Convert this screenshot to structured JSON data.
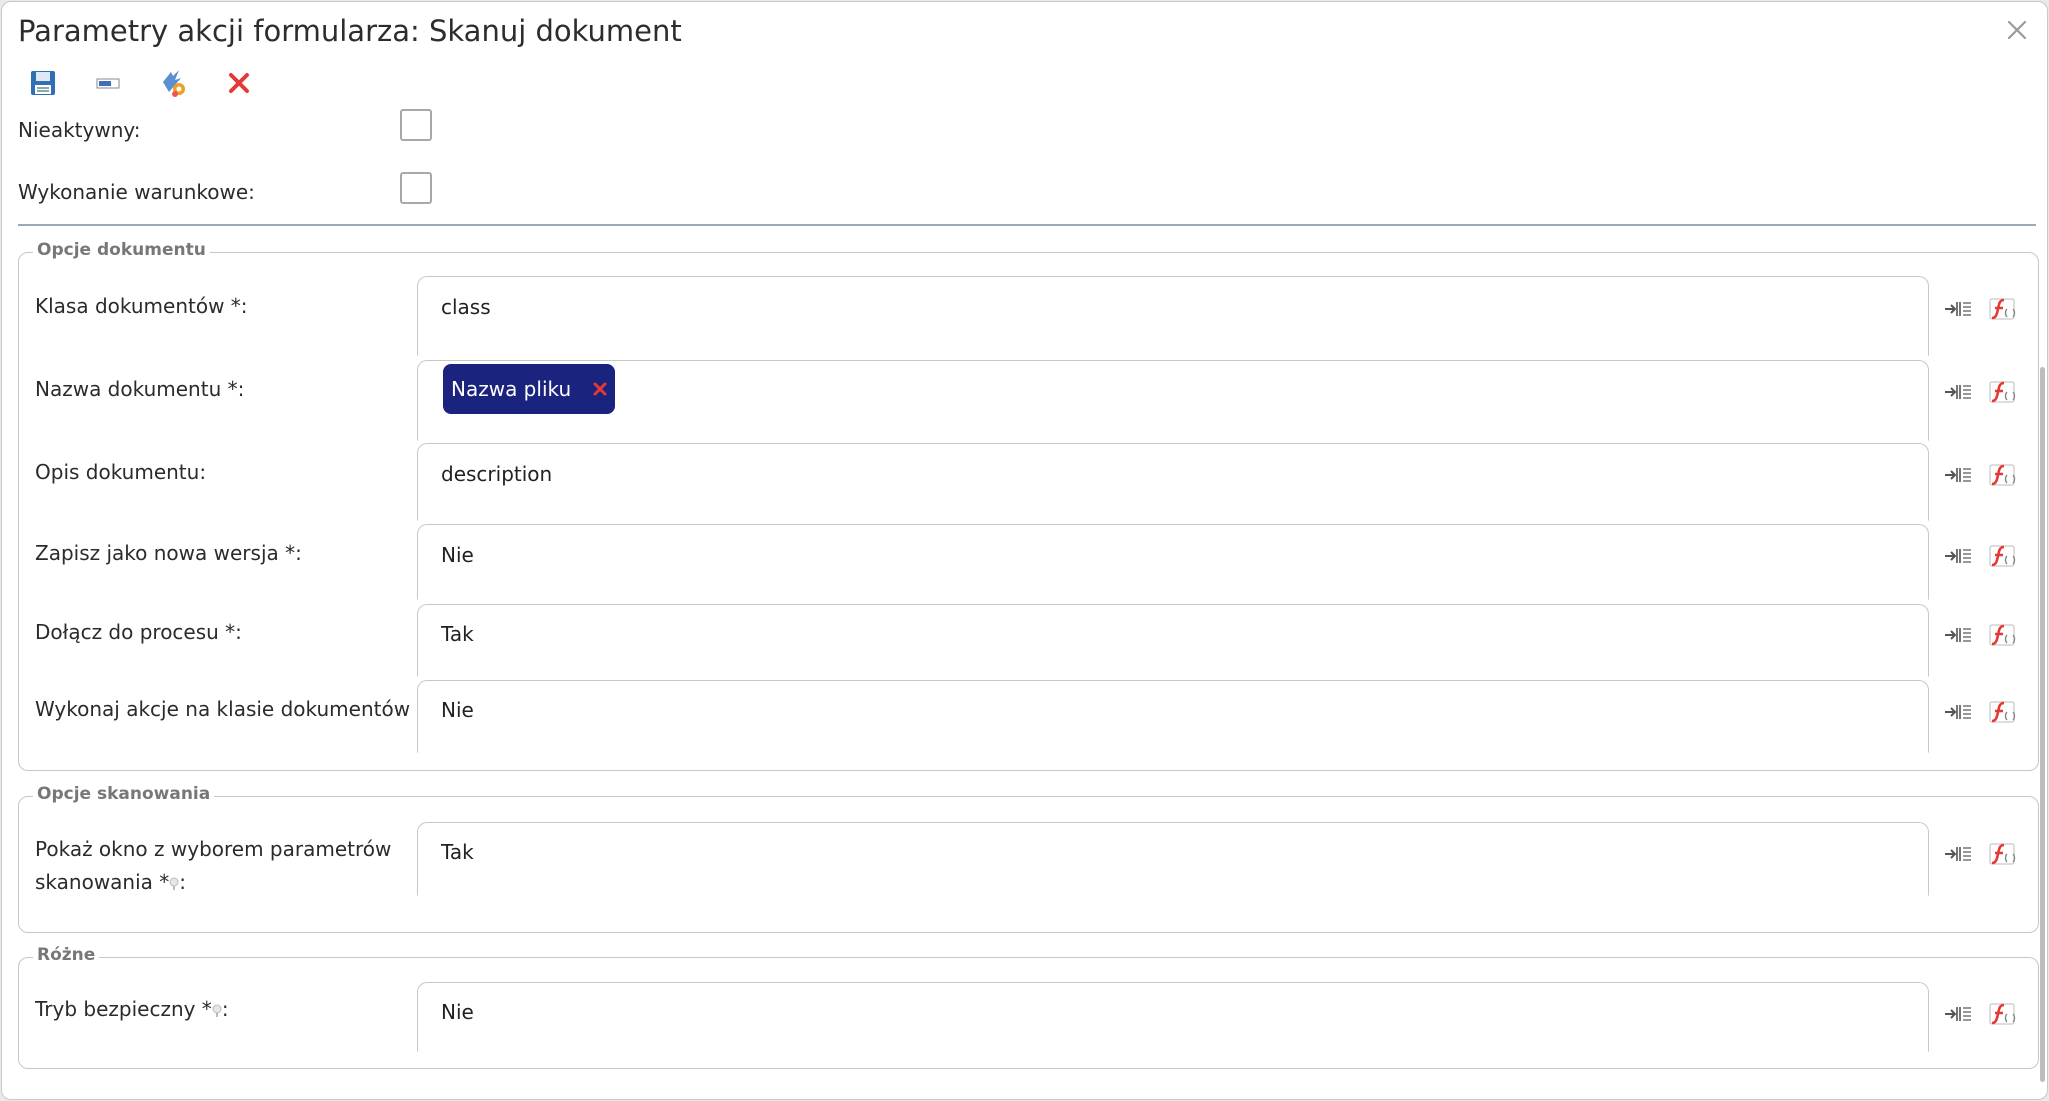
{
  "dialog": {
    "title": "Parametry akcji formularza: Skanuj dokument"
  },
  "toolbar": {
    "buttons": [
      {
        "name": "save-icon"
      },
      {
        "name": "form-field-icon"
      },
      {
        "name": "settings-variables-icon"
      },
      {
        "name": "delete-icon"
      }
    ]
  },
  "general": {
    "inactive_label": "Nieaktywny:",
    "inactive_checked": false,
    "conditional_label": "Wykonanie warunkowe:",
    "conditional_checked": false
  },
  "sections": {
    "document": {
      "legend": "Opcje dokumentu",
      "rows": [
        {
          "label": "Klasa dokumentów *:",
          "value": "class"
        },
        {
          "label": "Nazwa dokumentu *:",
          "tag": "Nazwa pliku"
        },
        {
          "label": "Opis dokumentu:",
          "value": "description"
        },
        {
          "label": "Zapisz jako nowa wersja *:",
          "value": "Nie"
        },
        {
          "label": "Dołącz do procesu *:",
          "value": "Tak"
        },
        {
          "label": "Wykonaj akcje na klasie dokumentów *:",
          "value": "Nie"
        }
      ]
    },
    "scan": {
      "legend": "Opcje skanowania",
      "rows": [
        {
          "label_line1": "Pokaż okno z wyborem parametrów",
          "label_line2": "skanowania *",
          "label_suffix": ":",
          "value": "Tak"
        }
      ]
    },
    "misc": {
      "legend": "Różne",
      "rows": [
        {
          "label": "Tryb bezpieczny *",
          "label_suffix": ":",
          "value": "Nie"
        }
      ]
    }
  },
  "colors": {
    "tag_bg": "#1a237e",
    "delete_red": "#e53935",
    "separator": "#9aaab8"
  }
}
